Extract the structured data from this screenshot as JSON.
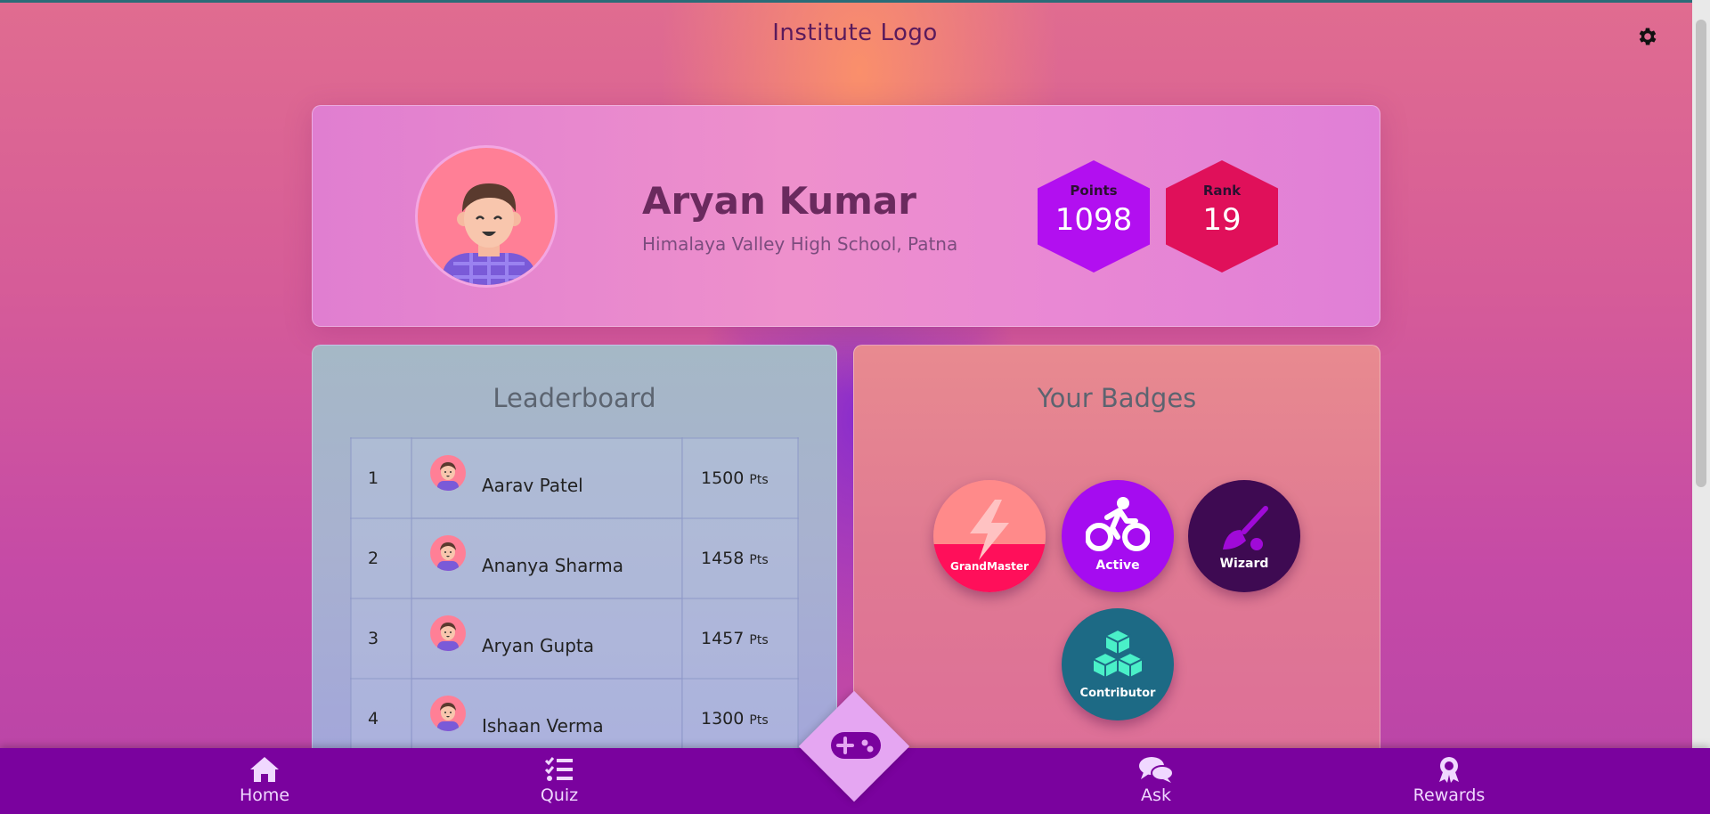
{
  "header": {
    "logo_text": "Institute Logo",
    "settings_icon": "gear-icon"
  },
  "profile": {
    "name": "Aryan Kumar",
    "school": "Himalaya Valley High School, Patna",
    "points_label": "Points",
    "points_value": "1098",
    "rank_label": "Rank",
    "rank_value": "19"
  },
  "leaderboard": {
    "title": "Leaderboard",
    "pts_unit": "Pts",
    "rows": [
      {
        "rank": "1",
        "name": "Aarav Patel",
        "points": "1500"
      },
      {
        "rank": "2",
        "name": "Ananya Sharma",
        "points": "1458"
      },
      {
        "rank": "3",
        "name": "Aryan Gupta",
        "points": "1457"
      },
      {
        "rank": "4",
        "name": "Ishaan Verma",
        "points": "1300"
      }
    ]
  },
  "badges": {
    "title": "Your Badges",
    "items": [
      {
        "label": "GrandMaster",
        "icon": "lightning-icon"
      },
      {
        "label": "Active",
        "icon": "bicycle-icon"
      },
      {
        "label": "Wizard",
        "icon": "wand-icon"
      },
      {
        "label": "Contributor",
        "icon": "cubes-icon"
      }
    ]
  },
  "nav": {
    "home": "Home",
    "quiz": "Quiz",
    "ask": "Ask",
    "rewards": "Rewards",
    "center_icon": "gamepad-icon"
  },
  "colors": {
    "nav_bg": "#7a029e",
    "points_hex": "#b20ff0",
    "rank_hex": "#e0105a"
  }
}
